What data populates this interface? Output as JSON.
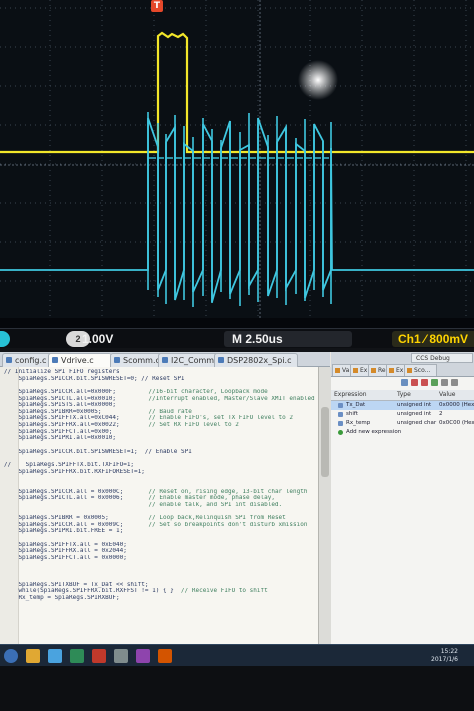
{
  "scope": {
    "trigger_marker": "T",
    "ch2_badge": "2",
    "volts_per_div": "1.00V",
    "volts_badge": "⊘",
    "time_per_div": "M 2.50us",
    "ch1_scale": "Ch1 ⁄ 800mV",
    "colors": {
      "ch1": "#f2e62a",
      "ch2": "#3fc7e0",
      "grid": "#3a4450"
    }
  },
  "ide": {
    "tabs": [
      "config.c",
      "Vdrive.c",
      "Scomm.c",
      "I2C_Comm.c",
      "DSP2802x_Spi.c"
    ],
    "active_tab_index": 1,
    "code_lines": [
      {
        "code": "// Initialize SPI FIFO registers",
        "comment": ""
      },
      {
        "code": "    SpiaRegs.SPICCR.bit.SPISWRESET=0; // Reset SPI",
        "comment": ""
      },
      {
        "code": "",
        "comment": ""
      },
      {
        "code": "    SpiaRegs.SPICCR.all=0x000F;",
        "comment": "//16-bit character, Loopback mode"
      },
      {
        "code": "    SpiaRegs.SPICTL.all=0x0010;",
        "comment": "//Interrupt enabled, Master/Slave XMIT enabled"
      },
      {
        "code": "    SpiaRegs.SPISTS.all=0x0000;",
        "comment": ""
      },
      {
        "code": "    SpiaRegs.SPIBRR=0x0005;",
        "comment": "// Baud rate"
      },
      {
        "code": "    SpiaRegs.SPIFFTX.all=0xC044;",
        "comment": "// Enable FIFO's, set TX FIFO level to 2"
      },
      {
        "code": "    SpiaRegs.SPIFFRX.all=0x0022;",
        "comment": "// Set RX FIFO level to 2"
      },
      {
        "code": "    SpiaRegs.SPIFFCT.all=0x00;",
        "comment": ""
      },
      {
        "code": "    SpiaRegs.SPIPRI.all=0x0010;",
        "comment": ""
      },
      {
        "code": "",
        "comment": ""
      },
      {
        "code": "    SpiaRegs.SPICCR.bit.SPISWRESET=1;  // Enable SPI",
        "comment": ""
      },
      {
        "code": "",
        "comment": ""
      },
      {
        "code": "//    SpiaRegs.SPIFFTX.bit.TXFIFO=1;",
        "comment": ""
      },
      {
        "code": "    SpiaRegs.SPIFFRX.bit.RXFIFORESET=1;",
        "comment": ""
      },
      {
        "code": "",
        "comment": ""
      },
      {
        "code": "",
        "comment": ""
      },
      {
        "code": "    SpiaRegs.SPICCR.all = 0x000C;",
        "comment": "// Reset on, rising edge, 13-bit char length"
      },
      {
        "code": "    SpiaRegs.SPICTL.all = 0x0006;",
        "comment": "// Enable master mode, phase delay,"
      },
      {
        "code": "",
        "comment": "// enable talk, and SPI int disabled."
      },
      {
        "code": "",
        "comment": ""
      },
      {
        "code": "    SpiaRegs.SPIBRR = 0x0005;",
        "comment": "// Loop back,Relinquish SPI from Reset"
      },
      {
        "code": "    SpiaRegs.SPICCR.all = 0x009C;",
        "comment": "// Set so breakpoints don't disturb xmission"
      },
      {
        "code": "    SpiaRegs.SPIPRI.bit.FREE = 1;",
        "comment": ""
      },
      {
        "code": "",
        "comment": ""
      },
      {
        "code": "    SpiaRegs.SPIFFTX.all = 0xE040;",
        "comment": ""
      },
      {
        "code": "    SpiaRegs.SPIFFRX.all = 0x2044;",
        "comment": ""
      },
      {
        "code": "    SpiaRegs.SPIFFCT.all = 0x0000;",
        "comment": ""
      },
      {
        "code": "",
        "comment": ""
      },
      {
        "code": "",
        "comment": ""
      },
      {
        "code": "",
        "comment": ""
      },
      {
        "code": "    SpiaRegs.SPITXBUF = Tx_Dat << shift;",
        "comment": ""
      },
      {
        "code": "    while(SpiaRegs.SPIFFRX.bit.RXFFST != 1) { }",
        "comment": "// Receive FIFO to shift"
      },
      {
        "code": "    Rx_temp = SpiaRegs.SPIRXBUF;",
        "comment": ""
      }
    ]
  },
  "debug": {
    "panel_tabs": [
      "Va...",
      "Ex...",
      "Re...",
      "Ex...",
      "Sco..."
    ],
    "ccs_debug": "CCS Debug",
    "columns": [
      "Expression",
      "Type",
      "Value"
    ],
    "rows": [
      {
        "name": "Tx_Dat",
        "type": "unsigned int",
        "value": "0x0000 (Hex)",
        "selected": true
      },
      {
        "name": "shift",
        "type": "unsigned int",
        "value": "2",
        "selected": false
      },
      {
        "name": "Rx_temp",
        "type": "unsigned char",
        "value": "0x0C00 (Hex)",
        "selected": false
      }
    ],
    "add_expression": "Add new expression"
  },
  "taskbar": {
    "time": "15:22",
    "date": "2017/1/6"
  }
}
